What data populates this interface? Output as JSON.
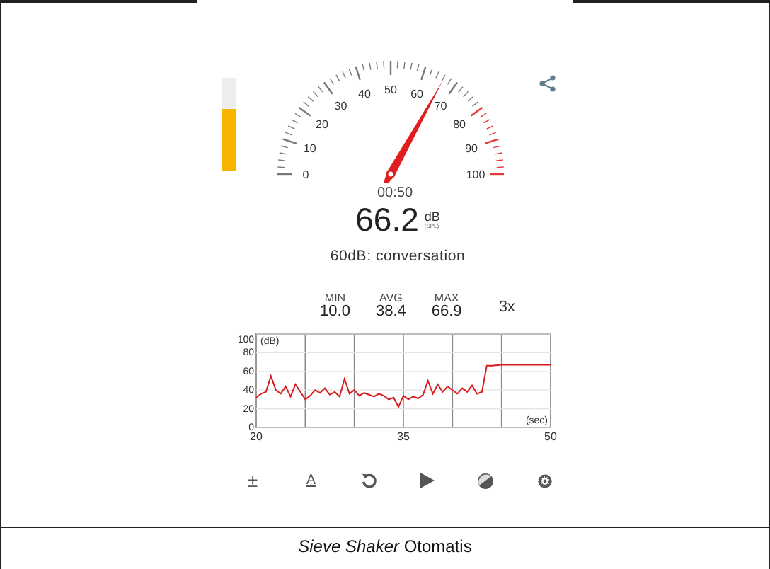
{
  "meter": {
    "level": 0.67
  },
  "gauge": {
    "tick_labels": [
      "0",
      "10",
      "20",
      "30",
      "40",
      "50",
      "60",
      "70",
      "80",
      "90",
      "100"
    ]
  },
  "time": "00:50",
  "reading": "66.2",
  "unit": "dB",
  "unit_note": "(SPL)",
  "description": "60dB: conversation",
  "stats": [
    {
      "label": "MIN",
      "value": "10.0"
    },
    {
      "label": "AVG",
      "value": "38.4"
    },
    {
      "label": "MAX",
      "value": "66.9"
    }
  ],
  "speed_button": "3x",
  "chart_data": {
    "type": "line",
    "grid": true,
    "xlabel": "(sec)",
    "ylabel": "(dB)",
    "xlim": [
      20,
      50
    ],
    "ylim": [
      0,
      100
    ],
    "xticks": [
      20,
      35,
      50
    ],
    "yticks": [
      0,
      20,
      40,
      60,
      80,
      100
    ],
    "x": [
      20,
      20.5,
      21,
      21.5,
      22,
      22.5,
      23,
      23.5,
      24,
      24.5,
      25,
      25.5,
      26,
      26.5,
      27,
      27.5,
      28,
      28.5,
      29,
      29.5,
      30,
      30.5,
      31,
      31.5,
      32,
      32.5,
      33,
      33.5,
      34,
      34.5,
      35,
      35.5,
      36,
      36.5,
      37,
      37.5,
      38,
      38.5,
      39,
      39.5,
      40,
      40.5,
      41,
      41.5,
      42,
      42.5,
      43,
      43.5,
      44,
      45,
      46,
      47,
      48,
      49,
      50
    ],
    "series": [
      {
        "color": "#d81b1b",
        "values": [
          32,
          36,
          38,
          55,
          40,
          36,
          44,
          33,
          46,
          38,
          30,
          34,
          40,
          37,
          42,
          35,
          38,
          33,
          52,
          36,
          40,
          34,
          37,
          35,
          33,
          36,
          34,
          30,
          32,
          22,
          34,
          30,
          33,
          31,
          35,
          50,
          36,
          46,
          38,
          44,
          40,
          36,
          42,
          38,
          45,
          36,
          38,
          66,
          66,
          67,
          67,
          67,
          67,
          67,
          67
        ]
      }
    ]
  },
  "toolbar": [
    {
      "kind": "glyph",
      "text": "±"
    },
    {
      "kind": "underlined",
      "text": "A"
    },
    {
      "kind": "reset"
    },
    {
      "kind": "play"
    },
    {
      "kind": "theme"
    },
    {
      "kind": "settings"
    }
  ],
  "caption": "*Sieve Shaker* Otomatis"
}
